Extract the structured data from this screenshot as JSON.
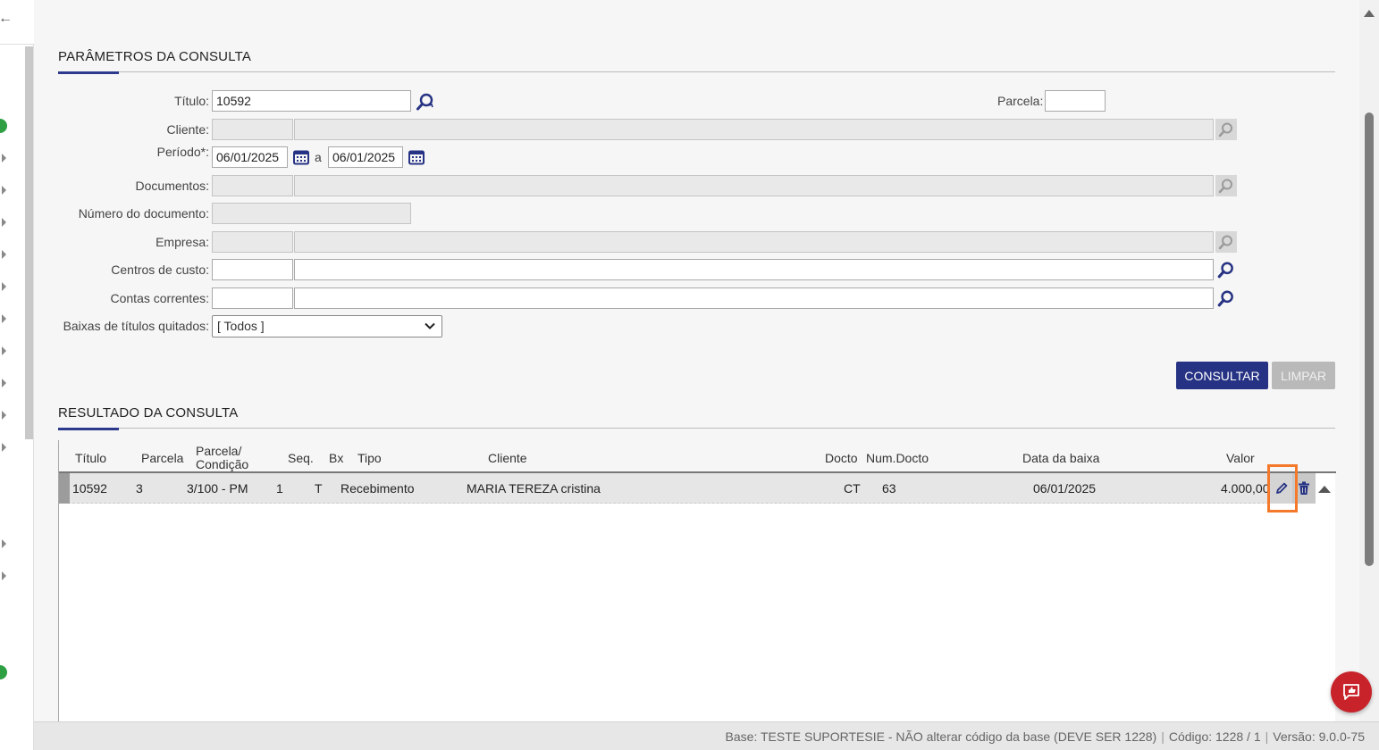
{
  "params": {
    "section_title": "PARÂMETROS DA CONSULTA",
    "titulo_label": "Título:",
    "titulo_value": "10592",
    "parcela_label": "Parcela:",
    "parcela_value": "",
    "cliente_label": "Cliente:",
    "periodo_label": "Período*:",
    "periodo_from": "06/01/2025",
    "periodo_sep": "a",
    "periodo_to": "06/01/2025",
    "documentos_label": "Documentos:",
    "numero_documento_label": "Número do documento:",
    "empresa_label": "Empresa:",
    "centros_custo_label": "Centros de custo:",
    "contas_correntes_label": "Contas correntes:",
    "baixas_label": "Baixas de títulos quitados:",
    "baixas_value": "[ Todos ]"
  },
  "buttons": {
    "consultar": "CONSULTAR",
    "limpar": "LIMPAR"
  },
  "results": {
    "section_title": "RESULTADO DA CONSULTA",
    "columns": {
      "titulo": "Título",
      "parcela": "Parcela",
      "parcela_condicao_1": "Parcela/",
      "parcela_condicao_2": "Condição",
      "seq": "Seq.",
      "bx": "Bx",
      "tipo": "Tipo",
      "cliente": "Cliente",
      "docto": "Docto",
      "num_docto": "Num.Docto",
      "data_baixa": "Data da baixa",
      "valor": "Valor"
    },
    "rows": [
      {
        "titulo": "10592",
        "parcela": "3",
        "condicao": "3/100 - PM",
        "seq": "1",
        "bx": "T",
        "tipo": "Recebimento",
        "cliente": "MARIA TEREZA cristina",
        "docto": "CT",
        "num_docto": "63",
        "data_baixa": "06/01/2025",
        "valor": "4.000,00"
      }
    ]
  },
  "status_bar": {
    "base": "Base: TESTE SUPORTESIE - NÃO alterar código da base (DEVE SER 1228)",
    "codigo": "Código: 1228 / 1",
    "versao": "Versão: 9.0.0-75"
  },
  "colors": {
    "primary": "#263283",
    "highlight": "#f5792a",
    "chat": "#c8232b"
  }
}
